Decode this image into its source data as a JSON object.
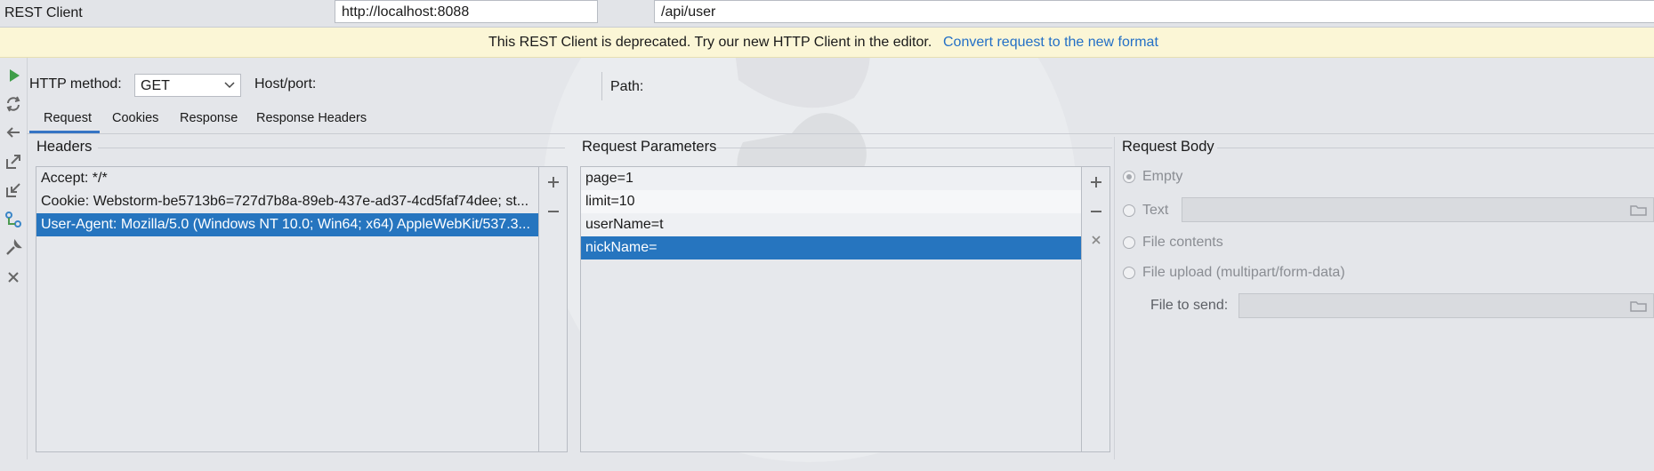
{
  "window": {
    "title": "REST Client"
  },
  "banner": {
    "message": "This REST Client is deprecated. Try our new HTTP Client in the editor.",
    "link": "Convert request to the new format"
  },
  "request_line": {
    "method_label": "HTTP method:",
    "method_value": "GET",
    "host_label": "Host/port:",
    "host_value": "http://localhost:8088",
    "path_label": "Path:",
    "path_value": "/api/user"
  },
  "tabs": [
    {
      "label": "Request",
      "selected": true
    },
    {
      "label": "Cookies",
      "selected": false
    },
    {
      "label": "Response",
      "selected": false
    },
    {
      "label": "Response Headers",
      "selected": false
    }
  ],
  "headers": {
    "title": "Headers",
    "items": [
      {
        "text": "Accept: */*",
        "selected": false
      },
      {
        "text": "Cookie: Webstorm-be5713b6=727d7b8a-89eb-437e-ad37-4cd5faf74dee; st...",
        "selected": false
      },
      {
        "text": "User-Agent: Mozilla/5.0 (Windows NT 10.0; Win64; x64) AppleWebKit/537.3...",
        "selected": true
      }
    ]
  },
  "params": {
    "title": "Request Parameters",
    "items": [
      {
        "text": "page=1",
        "selected": false
      },
      {
        "text": "limit=10",
        "selected": false
      },
      {
        "text": "userName=t",
        "selected": false
      },
      {
        "text": "nickName=",
        "selected": true
      }
    ]
  },
  "body": {
    "title": "Request Body",
    "options": [
      {
        "label": "Empty",
        "checked": true
      },
      {
        "label": "Text",
        "checked": false
      },
      {
        "label": "File contents",
        "checked": false
      },
      {
        "label": "File upload (multipart/form-data)",
        "checked": false
      }
    ],
    "file_to_send_label": "File to send:"
  },
  "icons": {
    "toolbar": [
      "run-icon",
      "refresh-icon",
      "back-icon",
      "export-icon",
      "import-icon",
      "generate-icon",
      "settings-wrench-icon",
      "close-icon"
    ],
    "title": [
      "gear-icon",
      "minimize-icon"
    ]
  },
  "colors": {
    "accent": "#2675bf",
    "run_green": "#3e9e48",
    "link": "#2470c6",
    "banner_bg": "#fbf6d6"
  }
}
